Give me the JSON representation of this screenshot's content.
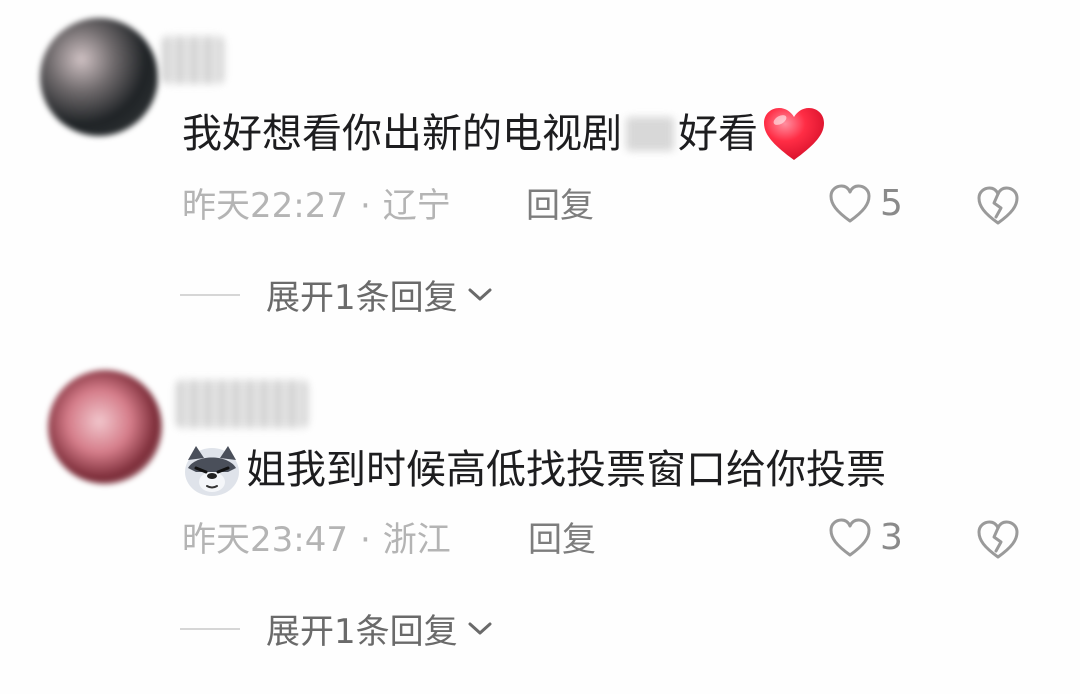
{
  "comments": [
    {
      "text_before": "我好想看你出新的电视剧",
      "text_after": "好看",
      "time": "昨天22:27",
      "location": "辽宁",
      "separator": "·",
      "reply_label": "回复",
      "likes": "5",
      "expand_label": "展开1条回复"
    },
    {
      "text": "姐我到时候高低找投票窗口给你投票",
      "time": "昨天23:47",
      "location": "浙江",
      "separator": "·",
      "reply_label": "回复",
      "likes": "3",
      "expand_label": "展开1条回复"
    }
  ],
  "icons": {
    "like": "heart-outline-icon",
    "dislike": "broken-heart-icon",
    "expand": "chevron-down-icon",
    "emoji_heart": "red-heart-emoji",
    "emoji_wolf": "wolf-emoji"
  },
  "colors": {
    "text_primary": "#1d1d1f",
    "text_meta": "#b4b4b4",
    "text_reply": "#7d7d7d",
    "heart_red": "#ff2d45"
  }
}
